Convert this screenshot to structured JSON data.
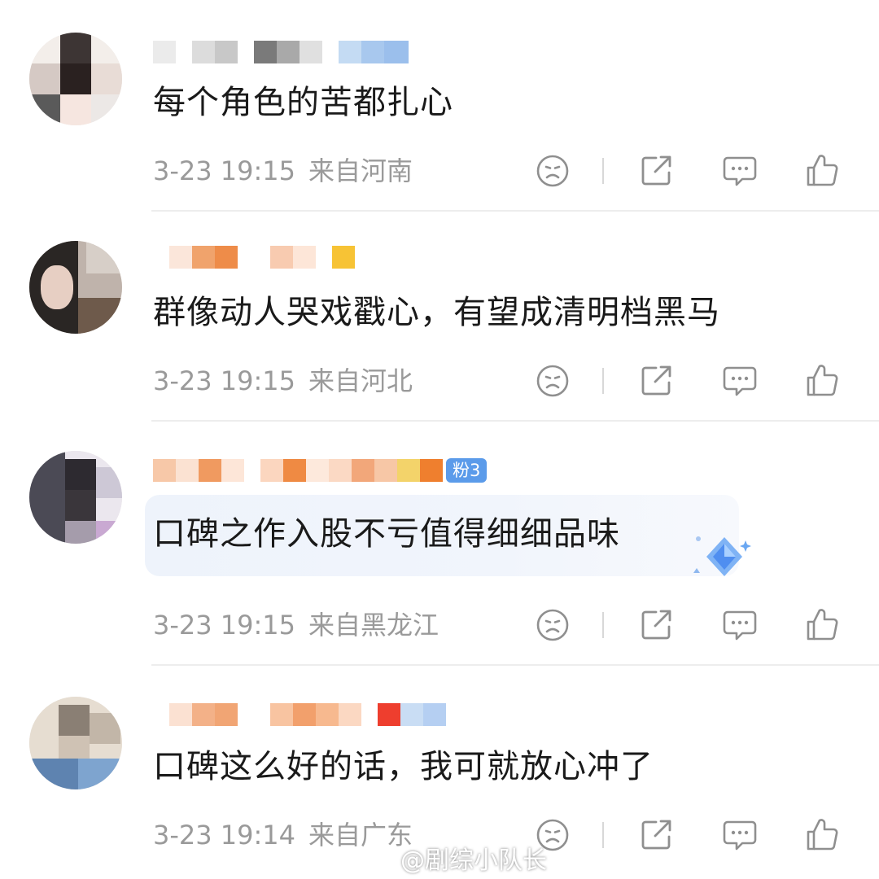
{
  "comments": [
    {
      "text": "每个角色的苦都扎心",
      "date": "3-23 19:15",
      "location": "来自河南",
      "badge": ""
    },
    {
      "text": "群像动人哭戏戳心，有望成清明档黑马",
      "date": "3-23 19:15",
      "location": "来自河北",
      "badge": ""
    },
    {
      "text": "口碑之作入股不亏值得细细品味",
      "date": "3-23 19:15",
      "location": "来自黑龙江",
      "badge": "粉3"
    },
    {
      "text": "口碑这么好的话，我可就放心冲了",
      "date": "3-23 19:14",
      "location": "来自广东",
      "badge": ""
    }
  ],
  "icons": {
    "dislike": "sad-face-icon",
    "share": "share-icon",
    "comment": "comment-bubble-icon",
    "like": "thumbs-up-icon"
  },
  "watermark": {
    "text": "@剧综小队长"
  },
  "colors": {
    "meta_text": "#9a9a9a",
    "icon_stroke": "#8f8f8f",
    "badge_blue": "#5b9bea",
    "divider": "#ededed"
  }
}
